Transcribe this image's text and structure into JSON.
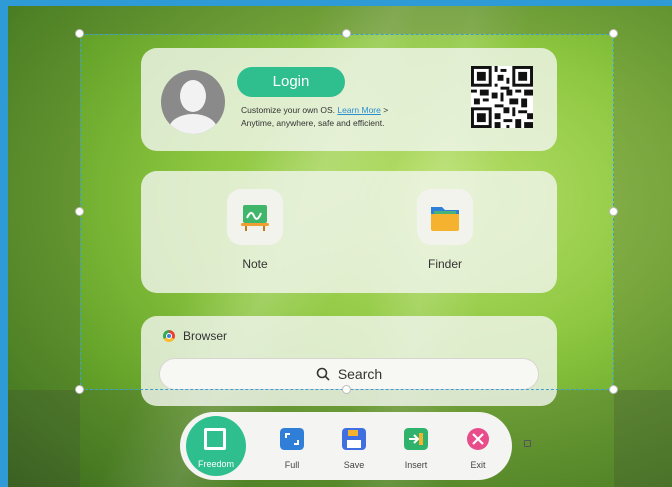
{
  "login_card": {
    "login_label": "Login",
    "line1_prefix": "Customize your own OS.",
    "learn_more": "Learn More",
    "line1_suffix": ">",
    "line2": "Anytime, anywhere, safe and efficient."
  },
  "apps": {
    "note_label": "Note",
    "finder_label": "Finder"
  },
  "browser": {
    "title": "Browser",
    "search_label": "Search"
  },
  "toolbar": {
    "freedom": "Freedom",
    "full": "Full",
    "save": "Save",
    "insert": "Insert",
    "exit": "Exit"
  },
  "colors": {
    "accent": "#2fbf8f",
    "link": "#2a8fd0",
    "selection_border": "#3aa0d0"
  }
}
